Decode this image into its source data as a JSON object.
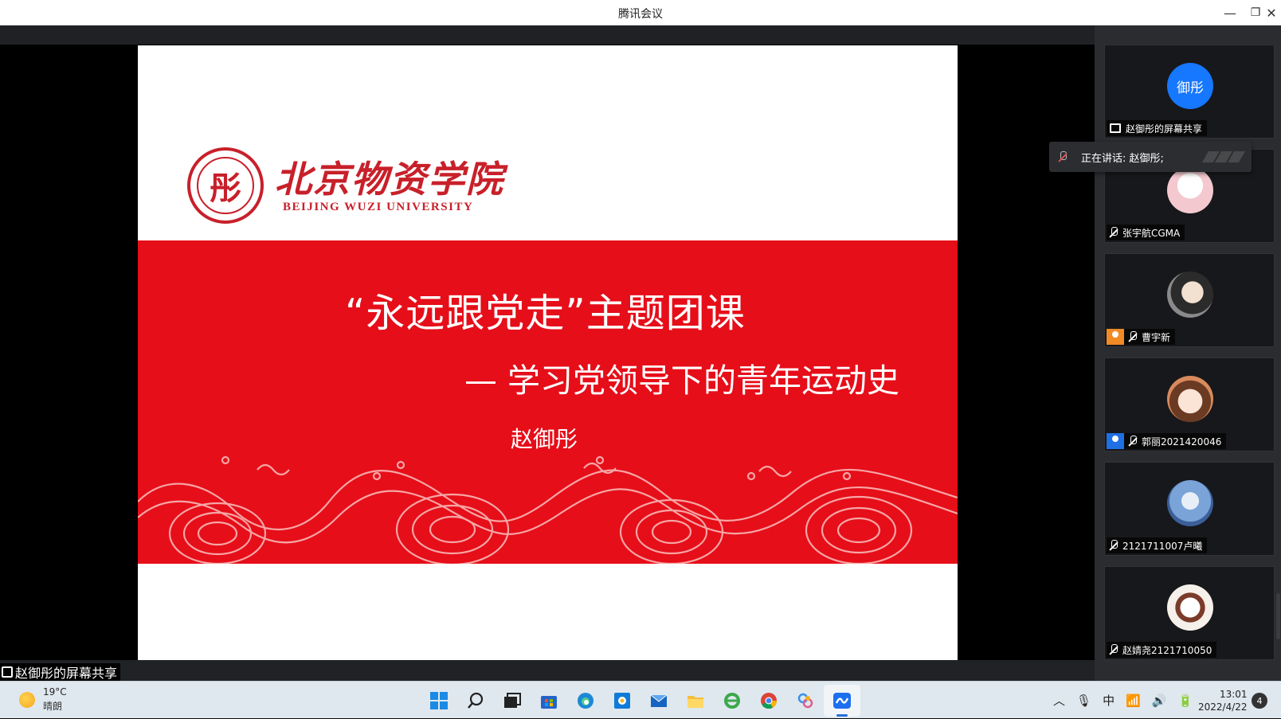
{
  "window": {
    "title": "腾讯会议",
    "minimize": "—",
    "restore": "❐",
    "close": "✕"
  },
  "slide": {
    "logo_seal": "彤",
    "logo_cn": "北京物资学院",
    "logo_en": "BEIJING WUZI UNIVERSITY",
    "title": "“永远跟党走”主题团课",
    "subtitle": "— 学习党领导下的青年运动史",
    "presenter": "赵御彤",
    "band_color": "#e60e19"
  },
  "share_label": "赵御彤的屏幕共享",
  "speaking": {
    "text": "正在讲话: 赵御彤;"
  },
  "participants": [
    {
      "name": "赵御彤的屏幕共享",
      "avatar_text": "御彤",
      "avatar_color": "#1677ff",
      "badge": "monitor"
    },
    {
      "name": "张宇航CGMA",
      "avatar_text": "",
      "avatar_color": "#f3c9cf",
      "badge": "mic-muted"
    },
    {
      "name": "曹宇新",
      "avatar_text": "",
      "avatar_color": "#5d6b74",
      "badge": "host-orange"
    },
    {
      "name": "郭丽2021420046",
      "avatar_text": "",
      "avatar_color": "#c77f5e",
      "badge": "cohost-blue"
    },
    {
      "name": "2121711007卢曦",
      "avatar_text": "",
      "avatar_color": "#7aa3d8",
      "badge": "mic-muted"
    },
    {
      "name": "赵婧尧2121710050",
      "avatar_text": "",
      "avatar_color": "#f5f0ea",
      "badge": "mic-muted"
    }
  ],
  "taskbar": {
    "weather_temp": "19°C",
    "weather_desc": "晴朗",
    "apps": [
      "start-icon",
      "search-icon",
      "task-view-icon",
      "store-icon",
      "edge-icon",
      "photos-icon",
      "mail-icon",
      "file-explorer-icon",
      "ie-icon",
      "chrome-icon",
      "baidu-netdisk-icon",
      "tencent-meeting-icon"
    ],
    "tray_ime": "中",
    "time": "13:01",
    "date": "2022/4/22",
    "notifications": "4"
  }
}
